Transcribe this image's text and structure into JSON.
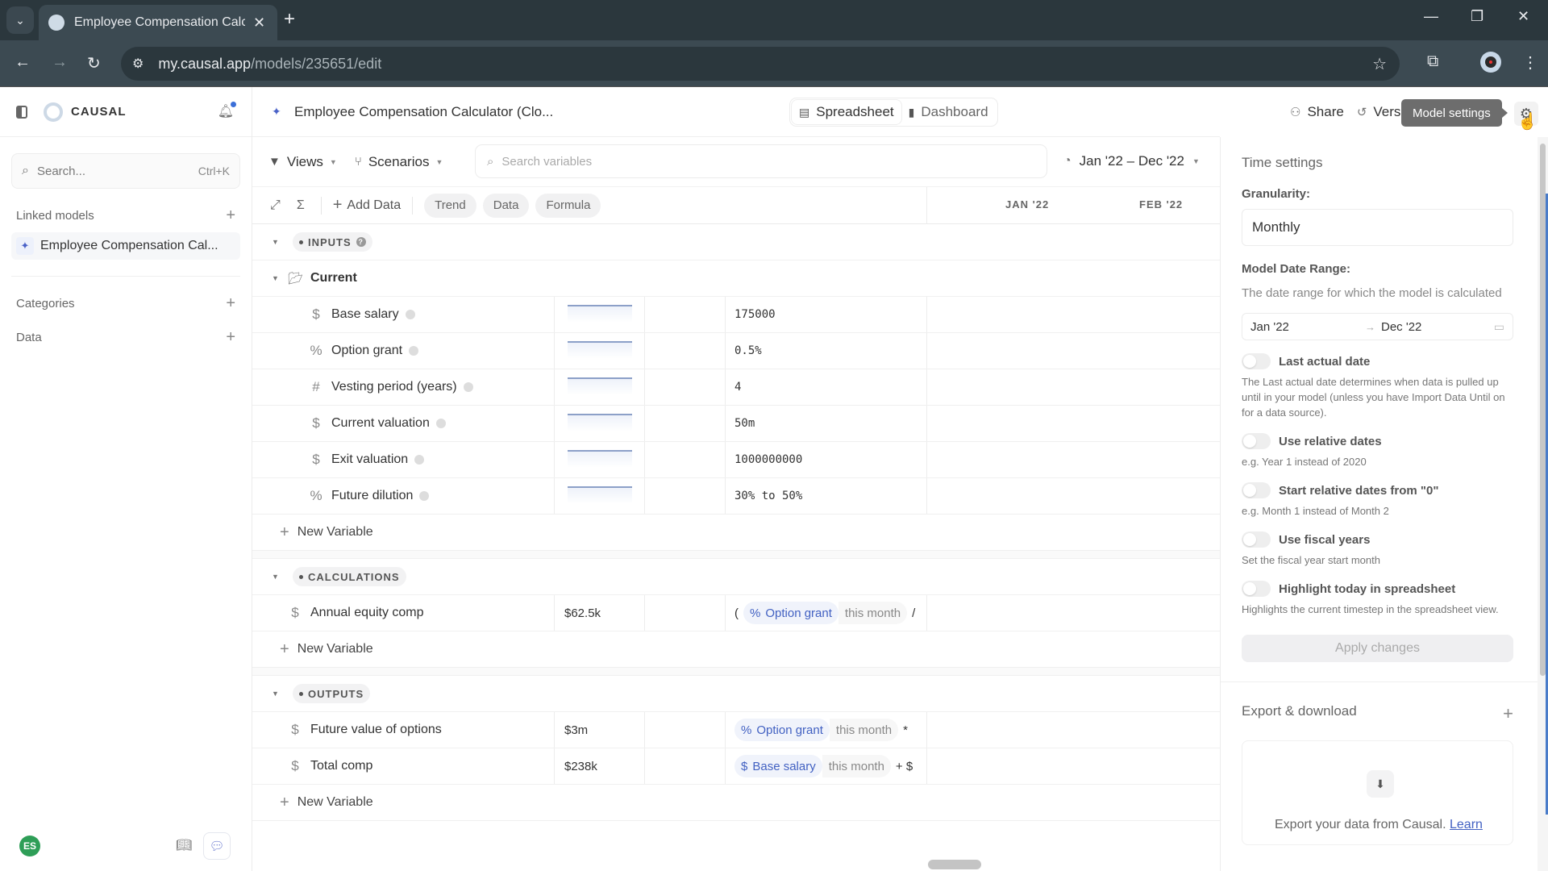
{
  "browser": {
    "tab_title": "Employee Compensation Calculator",
    "url_host": "my.causal.app",
    "url_path": "/models/235651/edit"
  },
  "sidebar": {
    "brand": "CAUSAL",
    "search_placeholder": "Search...",
    "search_shortcut": "Ctrl+K",
    "linked_models_label": "Linked models",
    "linked_models": [
      {
        "label": "Employee Compensation Cal..."
      }
    ],
    "categories_label": "Categories",
    "data_label": "Data",
    "user_initials": "ES"
  },
  "header": {
    "model_title": "Employee Compensation Calculator (Clo...",
    "views": [
      {
        "label": "Spreadsheet",
        "active": true
      },
      {
        "label": "Dashboard",
        "active": false
      }
    ],
    "share_label": "Share",
    "versions_label": "Versions",
    "tooltip": "Model settings"
  },
  "toolbar": {
    "views_label": "Views",
    "scenarios_label": "Scenarios",
    "search_placeholder": "Search variables",
    "date_range": "Jan '22 – Dec '22",
    "add_data_label": "Add Data",
    "pills": [
      "Trend",
      "Data",
      "Formula"
    ],
    "columns": [
      "JAN '22",
      "FEB '22"
    ]
  },
  "groups": {
    "inputs": {
      "label": "INPUTS",
      "folder": "Current",
      "variables": [
        {
          "icon": "$",
          "name": "Base salary",
          "value": "175000"
        },
        {
          "icon": "%",
          "name": "Option grant",
          "value": "0.5%"
        },
        {
          "icon": "#",
          "name": "Vesting period (years)",
          "value": "4"
        },
        {
          "icon": "$",
          "name": "Current valuation",
          "value": "50m"
        },
        {
          "icon": "$",
          "name": "Exit valuation",
          "value": "1000000000"
        },
        {
          "icon": "$",
          "name": "Future dilution",
          "value": "30% to 50%"
        }
      ]
    },
    "calculations": {
      "label": "CALCULATIONS",
      "variables": [
        {
          "icon": "$",
          "name": "Annual equity comp",
          "value": "$62.5k",
          "formula_prefix": "(",
          "ref_sym": "%",
          "ref": "Option grant",
          "mod": "this month",
          "op": "/"
        }
      ]
    },
    "outputs": {
      "label": "OUTPUTS",
      "variables": [
        {
          "icon": "$",
          "name": "Future value of options",
          "value": "$3m",
          "ref_sym": "%",
          "ref": "Option grant",
          "mod": "this month",
          "op": "*"
        },
        {
          "icon": "$",
          "name": "Total comp",
          "value": "$238k",
          "ref_sym": "$",
          "ref": "Base salary",
          "mod": "this month",
          "op": "+ $"
        }
      ]
    },
    "new_variable_label": "New Variable"
  },
  "settings": {
    "title": "Time settings",
    "granularity_label": "Granularity:",
    "granularity_value": "Monthly",
    "range_label": "Model Date Range:",
    "range_desc": "The date range for which the model is calculated",
    "range_start": "Jan '22",
    "range_end": "Dec '22",
    "toggles": [
      {
        "label": "Last actual date",
        "desc": "The Last actual date determines when data is pulled up until in your model (unless you have Import Data Until on for a data source).",
        "on": false
      },
      {
        "label": "Use relative dates",
        "desc": "e.g. Year 1 instead of 2020",
        "on": false
      },
      {
        "label": "Start relative dates from \"0\"",
        "desc": "e.g. Month 1 instead of Month 2",
        "on": false
      },
      {
        "label": "Use fiscal years",
        "desc": "Set the fiscal year start month",
        "on": false
      },
      {
        "label": "Highlight today in spreadsheet",
        "desc": "Highlights the current timestep in the spreadsheet view.",
        "on": false
      }
    ],
    "apply_label": "Apply changes",
    "export_title": "Export & download",
    "export_text": "Export your data from Causal.",
    "export_link": "Learn"
  }
}
